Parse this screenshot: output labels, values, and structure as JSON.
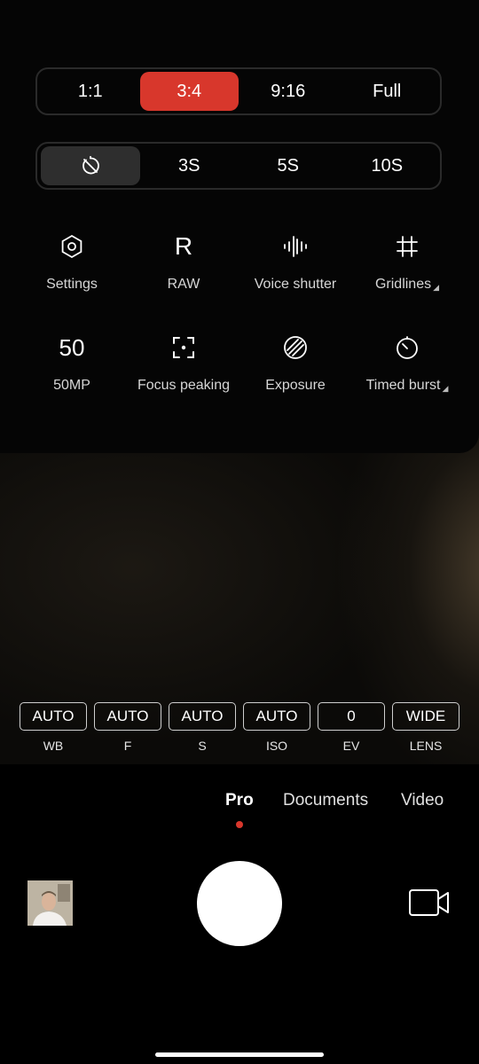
{
  "aspect_ratio": {
    "options": [
      "1:1",
      "3:4",
      "9:16",
      "Full"
    ],
    "selected": "3:4",
    "accent_color": "#d8372c"
  },
  "timer": {
    "off_icon": "timer-off-icon",
    "options": [
      "3S",
      "5S",
      "10S"
    ],
    "selected": "off"
  },
  "quick_settings": {
    "row1": [
      {
        "icon": "hexagon-settings-icon",
        "label": "Settings"
      },
      {
        "icon": "raw-letter-icon",
        "glyph": "R",
        "label": "RAW"
      },
      {
        "icon": "waveform-icon",
        "label": "Voice shutter"
      },
      {
        "icon": "grid-icon",
        "label": "Gridlines"
      }
    ],
    "row2": [
      {
        "icon": "megapixel-icon",
        "glyph": "50",
        "label": "50MP"
      },
      {
        "icon": "focus-peaking-icon",
        "label": "Focus peaking"
      },
      {
        "icon": "exposure-stripes-icon",
        "label": "Exposure"
      },
      {
        "icon": "timer-icon",
        "label": "Timed burst"
      }
    ]
  },
  "pro_params": [
    {
      "value": "AUTO",
      "name": "WB"
    },
    {
      "value": "AUTO",
      "name": "F"
    },
    {
      "value": "AUTO",
      "name": "S"
    },
    {
      "value": "AUTO",
      "name": "ISO"
    },
    {
      "value": "0",
      "name": "EV"
    },
    {
      "value": "WIDE",
      "name": "LENS"
    }
  ],
  "modes": {
    "items": [
      "Pro",
      "Documents",
      "Video"
    ],
    "selected": "Pro"
  }
}
